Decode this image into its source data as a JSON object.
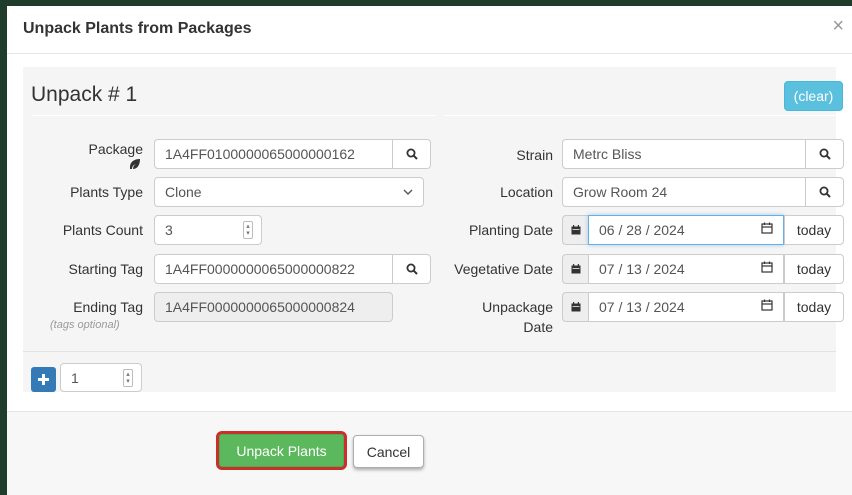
{
  "dialog": {
    "title": "Unpack Plants from Packages",
    "close_label": "×"
  },
  "unpack": {
    "heading": "Unpack # 1",
    "clear_label": "(clear)"
  },
  "left_form": {
    "package": {
      "label": "Package",
      "value": "1A4FF0100000065000000162"
    },
    "plants_type": {
      "label": "Plants Type",
      "value": "Clone"
    },
    "plants_count": {
      "label": "Plants Count",
      "value": "3"
    },
    "starting_tag": {
      "label": "Starting Tag",
      "value": "1A4FF0000000065000000822"
    },
    "ending_tag": {
      "label": "Ending Tag",
      "sublabel": "(tags optional)",
      "value": "1A4FF0000000065000000824"
    }
  },
  "right_form": {
    "strain": {
      "label": "Strain",
      "value": "Metrc Bliss"
    },
    "location": {
      "label": "Location",
      "value": "Grow Room 24"
    },
    "planting_date": {
      "label": "Planting Date",
      "value": "06 / 28 / 2024",
      "today_label": "today"
    },
    "vegetative_date": {
      "label": "Vegetative Date",
      "value": "07 / 13 / 2024",
      "today_label": "today"
    },
    "unpackage_date": {
      "label_line1": "Unpackage",
      "label_line2": "Date",
      "value": "07 / 13 / 2024",
      "today_label": "today"
    }
  },
  "add_row": {
    "quantity": "1"
  },
  "footer": {
    "unpack_label": "Unpack Plants",
    "cancel_label": "Cancel"
  },
  "colors": {
    "header_bg": "#ffffff",
    "info": "#5bc0de",
    "primary": "#337ab7",
    "success": "#5cb85c",
    "highlight": "#c9302c"
  },
  "icons": {
    "search": "search-icon",
    "leaf": "leaf-icon",
    "calendar": "calendar-icon",
    "plus": "plus-icon",
    "close": "close-icon"
  }
}
